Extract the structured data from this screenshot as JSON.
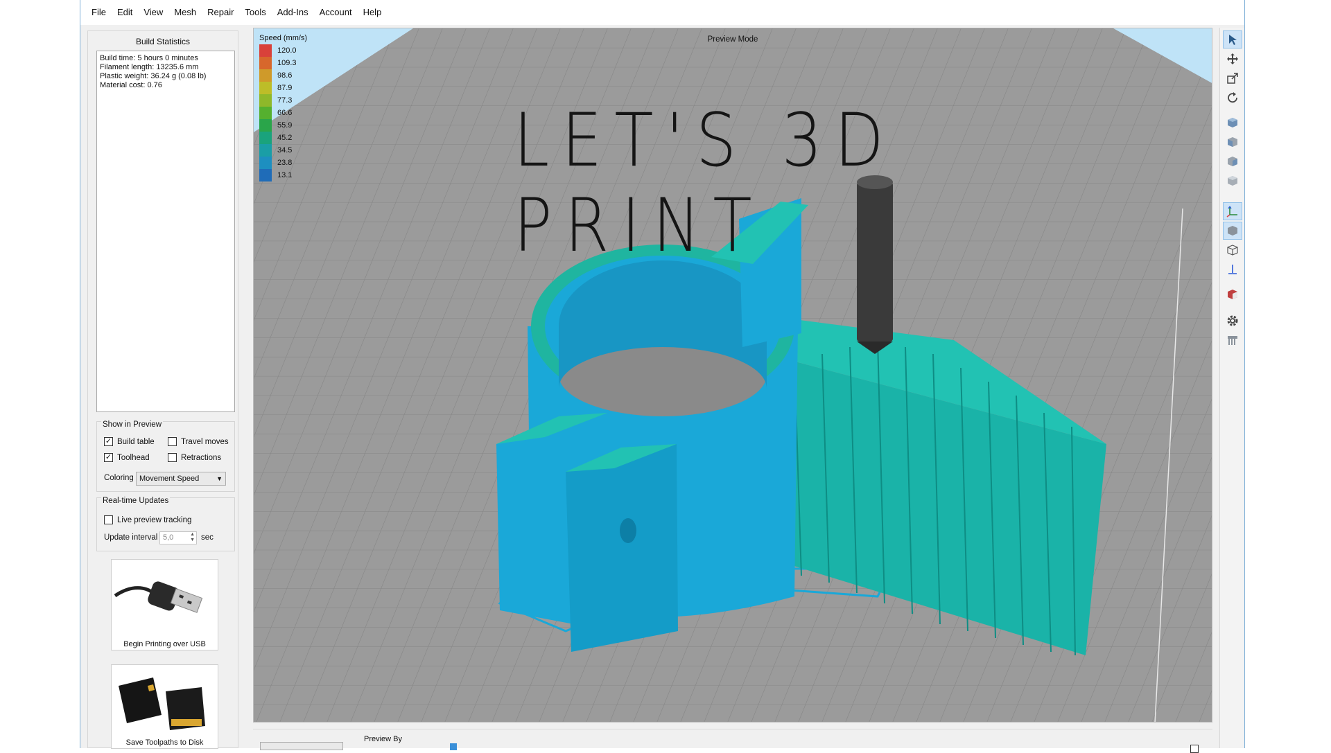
{
  "menu": [
    "File",
    "Edit",
    "View",
    "Mesh",
    "Repair",
    "Tools",
    "Add-Ins",
    "Account",
    "Help"
  ],
  "build_stats": {
    "title": "Build Statistics",
    "lines": [
      "Build time: 5 hours 0 minutes",
      "Filament length: 13235.6 mm",
      "Plastic weight: 36.24 g (0.08 lb)",
      "Material cost: 0.76"
    ]
  },
  "show_in_preview": {
    "title": "Show in Preview",
    "build_table": {
      "label": "Build table",
      "checked": true
    },
    "travel_moves": {
      "label": "Travel moves",
      "checked": false
    },
    "toolhead": {
      "label": "Toolhead",
      "checked": true
    },
    "retractions": {
      "label": "Retractions",
      "checked": false
    },
    "coloring_label": "Coloring",
    "coloring_value": "Movement Speed"
  },
  "realtime": {
    "title": "Real-time Updates",
    "live_tracking": {
      "label": "Live preview tracking",
      "checked": false
    },
    "interval_label": "Update interval",
    "interval_value": "5,0",
    "interval_unit": "sec"
  },
  "usb_card": {
    "label": "Begin Printing over USB",
    "icon": "usb-cable-icon"
  },
  "sd_card": {
    "label": "Save Toolpaths to Disk",
    "icon": "sd-card-icon"
  },
  "viewport": {
    "mode_label": "Preview Mode",
    "overlay_text": "LET'S 3D PRINT"
  },
  "legend": {
    "title": "Speed (mm/s)",
    "items": [
      {
        "value": "120.0",
        "color": "#d9413a"
      },
      {
        "value": "109.3",
        "color": "#d7672c"
      },
      {
        "value": "98.6",
        "color": "#cf9a2a"
      },
      {
        "value": "87.9",
        "color": "#bdbd28"
      },
      {
        "value": "77.3",
        "color": "#8fb82a"
      },
      {
        "value": "66.6",
        "color": "#55b02f"
      },
      {
        "value": "55.9",
        "color": "#2aa54a"
      },
      {
        "value": "45.2",
        "color": "#1aa37c"
      },
      {
        "value": "34.5",
        "color": "#1a9ea6"
      },
      {
        "value": "23.8",
        "color": "#1d8fc0"
      },
      {
        "value": "13.1",
        "color": "#1f6cb8"
      }
    ]
  },
  "bottom": {
    "preview_by": "Preview By"
  },
  "colors": {
    "part_blue": "#1aa8d8",
    "part_teal": "#1ab3a8",
    "bed": "#9b9b9b",
    "accent": "#3a8fd8"
  }
}
